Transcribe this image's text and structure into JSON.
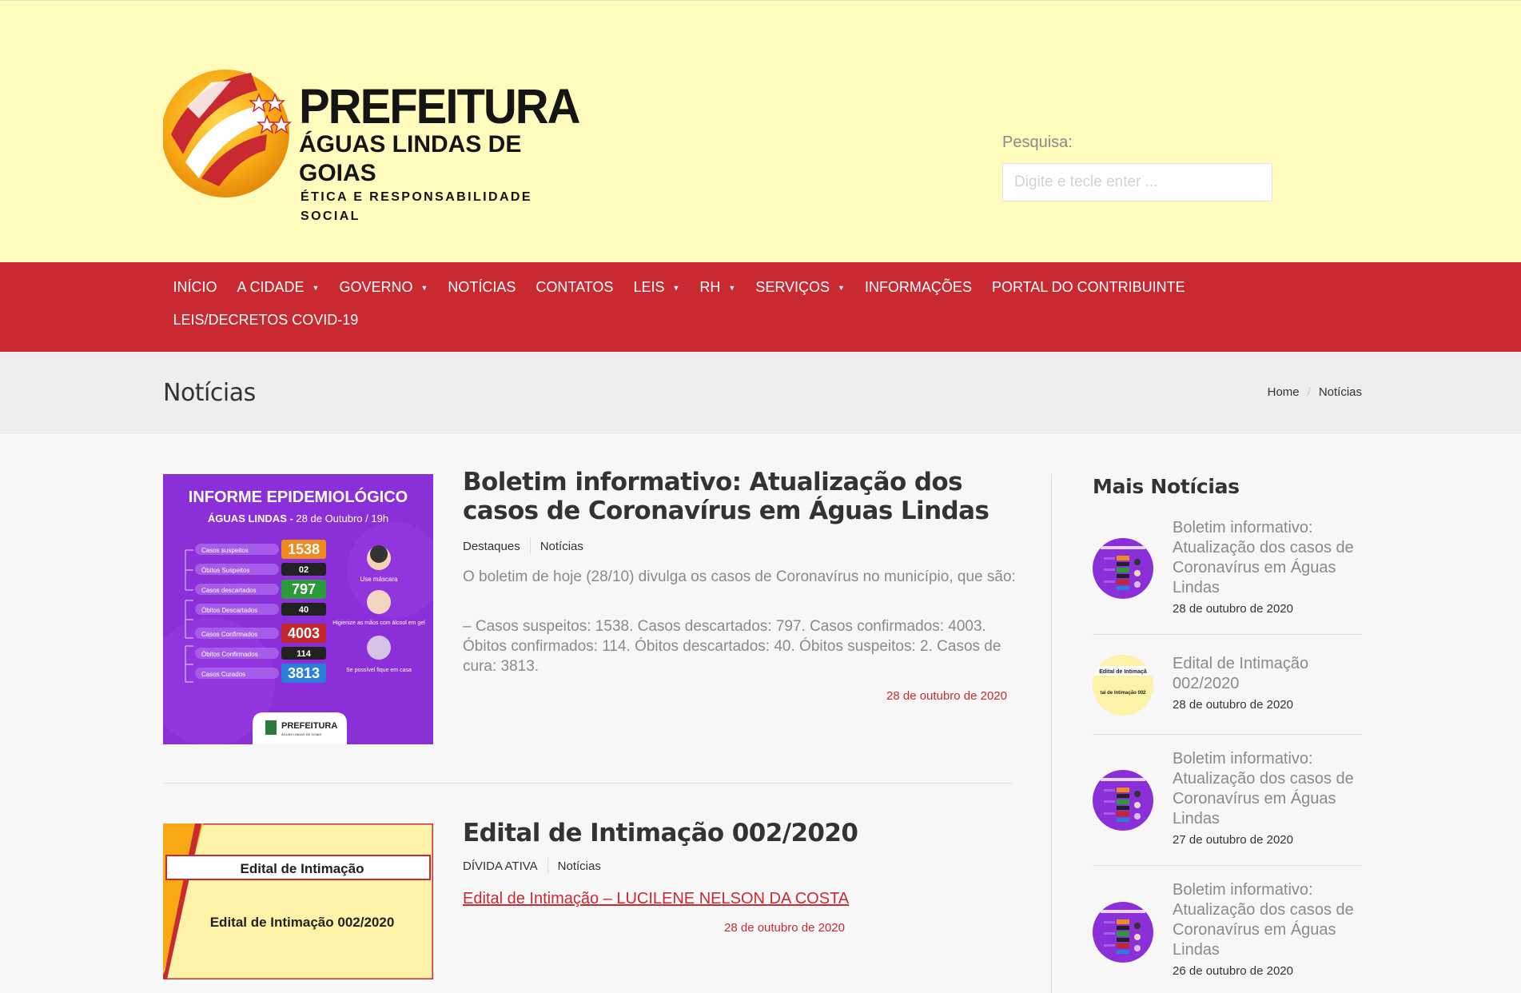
{
  "header": {
    "logo": {
      "line1": "PREFEITURA",
      "line2": "ÁGUAS LINDAS DE GOIAS",
      "line3": "ÉTICA E RESPONSABILIDADE SOCIAL"
    },
    "search_label": "Pesquisa:",
    "search_placeholder": "Digite e tecle enter ...",
    "search_value": ""
  },
  "nav": {
    "row1": [
      {
        "label": "INÍCIO",
        "dropdown": false
      },
      {
        "label": "A CIDADE",
        "dropdown": true
      },
      {
        "label": "GOVERNO",
        "dropdown": true
      },
      {
        "label": "NOTÍCIAS",
        "dropdown": false
      },
      {
        "label": "CONTATOS",
        "dropdown": false
      },
      {
        "label": "LEIS",
        "dropdown": true
      },
      {
        "label": "RH",
        "dropdown": true
      },
      {
        "label": "SERVIÇOS",
        "dropdown": true
      },
      {
        "label": "INFORMAÇÕES",
        "dropdown": false
      },
      {
        "label": "PORTAL DO CONTRIBUINTE",
        "dropdown": false
      }
    ],
    "row2": [
      {
        "label": "LEIS/DECRETOS COVID-19",
        "dropdown": false
      }
    ],
    "caret": "▼"
  },
  "titlebar": {
    "title": "Notícias",
    "breadcrumb": [
      "Home",
      "/",
      "Notícias"
    ]
  },
  "articles": [
    {
      "title": "Boletim informativo: Atualização dos casos de Coronavírus em Águas Lindas",
      "categories": [
        "Destaques",
        "Notícias"
      ],
      "excerpt": [
        "O boletim de hoje (28/10) divulga os casos de Coronavírus no município, que são:",
        "–  Casos suspeitos: 1538. Casos descartados: 797. Casos confirmados: 4003. Óbitos confirmados: 114. Óbitos descartados: 40. Óbitos suspeitos: 2. Casos de cura: 3813."
      ],
      "date": "28 de outubro de 2020",
      "image": {
        "heading": "INFORME EPIDEMIOLÓGICO",
        "subheading_bold": "ÁGUAS LINDAS -",
        "subheading_rest": " 28 de Outubro / 19h",
        "stats": [
          {
            "label": "Casos suspeitos",
            "value": "1538",
            "color": "#f08a1c"
          },
          {
            "label": "Óbitos Suspeitos",
            "value": "02",
            "color": "#222222"
          },
          {
            "label": "Casos descartados",
            "value": "797",
            "color": "#2a9a3a"
          },
          {
            "label": "Óbitos Descartados",
            "value": "40",
            "color": "#222222"
          },
          {
            "label": "Casos Confirmados",
            "value": "4003",
            "color": "#c1272d"
          },
          {
            "label": "Óbitos Confirmados",
            "value": "114",
            "color": "#222222"
          },
          {
            "label": "Casos Curados",
            "value": "3813",
            "color": "#2a7fd8"
          }
        ],
        "tips": [
          "Use máscara",
          "Higienize as mãos com álcool em gel",
          "Se possível fique em casa"
        ],
        "badge": "PREFEITURA",
        "badge_sub": "ÁGUAS LINDAS DE GOIAS"
      }
    },
    {
      "title": "Edital de Intimação 002/2020",
      "categories": [
        "DÍVIDA ATIVA",
        "Notícias"
      ],
      "link": "Edital de Intimação – LUCILENE NELSON DA COSTA",
      "date": "28 de outubro de 2020",
      "image": {
        "line1": "Edital de Intimação",
        "line2": "Edital de Intimação 002/2020"
      }
    }
  ],
  "sidebar": {
    "title": "Mais Notícias",
    "items": [
      {
        "title": "Boletim informativo: Atualização dos casos de Coronavírus em Águas Lindas",
        "date": "28 de outubro de 2020",
        "type": "covid"
      },
      {
        "title": "Edital de Intimação 002/2020",
        "date": "28 de outubro de 2020",
        "type": "edital",
        "thumb_line1": "Edital de Intimaçã",
        "thumb_line2": "tal de Intimação 002"
      },
      {
        "title": "Boletim informativo: Atualização dos casos de Coronavírus em Águas Lindas",
        "date": "27 de outubro de 2020",
        "type": "covid"
      },
      {
        "title": "Boletim informativo: Atualização dos casos de Coronavírus em Águas Lindas",
        "date": "26 de outubro de 2020",
        "type": "covid"
      }
    ]
  },
  "colors": {
    "header_bg": "#fefbbd",
    "nav_bg": "#c92a31",
    "accent": "#c92a31",
    "titlebar_bg": "#eeeeee",
    "purple": "#8a2be2"
  }
}
